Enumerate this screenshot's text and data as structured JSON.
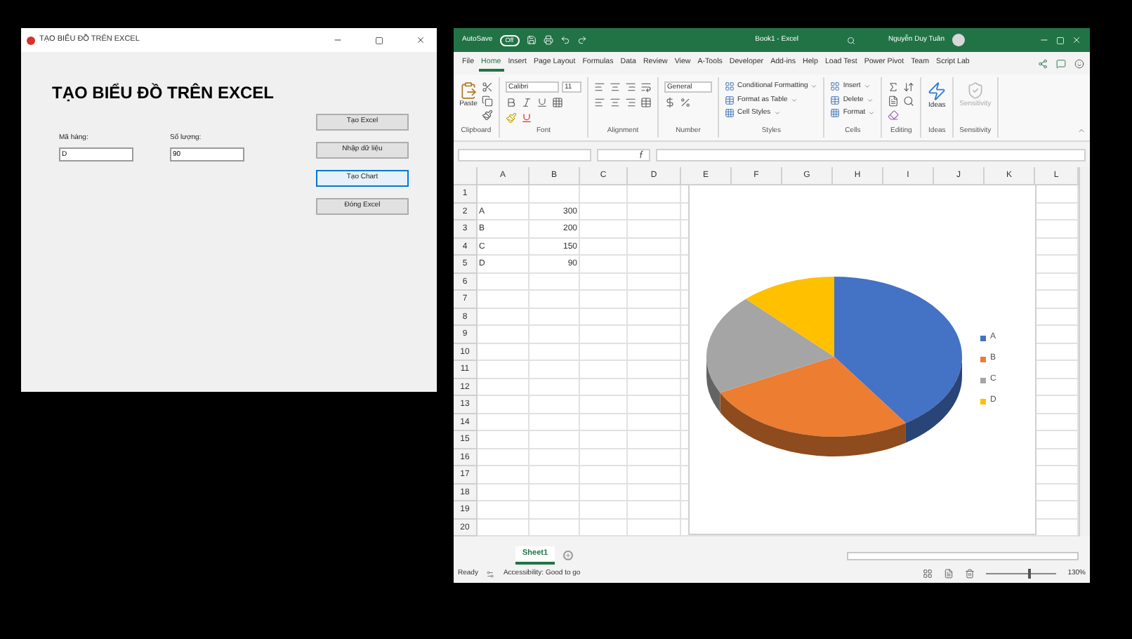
{
  "app_window": {
    "title": "TẠO BIỂU ĐỒ TRÊN EXCEL",
    "heading": "TẠO BIỂU ĐỒ TRÊN EXCEL",
    "fields": [
      {
        "label": "Mã hàng:",
        "value": "D"
      },
      {
        "label": "Số lượng:",
        "value": "90"
      }
    ],
    "buttons": [
      {
        "label": "Tạo Excel",
        "selected": false
      },
      {
        "label": "Nhập dữ liệu",
        "selected": false
      },
      {
        "label": "Tạo Chart",
        "selected": true
      },
      {
        "label": "Đóng Excel",
        "selected": false
      }
    ]
  },
  "excel": {
    "title_bar": {
      "autosave_label": "AutoSave",
      "autosave_toggle": "Off",
      "document_title": "Book1 - Excel",
      "user": "Nguyễn Duy Tuân"
    },
    "ribbon_tabs": [
      {
        "label": "File",
        "selected": false
      },
      {
        "label": "Home",
        "selected": true
      },
      {
        "label": "Insert",
        "selected": false
      },
      {
        "label": "Page Layout",
        "selected": false
      },
      {
        "label": "Formulas",
        "selected": false
      },
      {
        "label": "Data",
        "selected": false
      },
      {
        "label": "Review",
        "selected": false
      },
      {
        "label": "View",
        "selected": false
      },
      {
        "label": "A-Tools",
        "selected": false
      },
      {
        "label": "Developer",
        "selected": false
      },
      {
        "label": "Add-ins",
        "selected": false
      },
      {
        "label": "Help",
        "selected": false
      },
      {
        "label": "Load Test",
        "selected": false
      },
      {
        "label": "Power Pivot",
        "selected": false
      },
      {
        "label": "Team",
        "selected": false
      },
      {
        "label": "Script Lab",
        "selected": false
      }
    ],
    "ribbon_groups": [
      {
        "kind": "clipboard",
        "label": "Clipboard",
        "items": [
          "Paste"
        ]
      },
      {
        "kind": "font",
        "label": "Font",
        "items": [
          "Calibri",
          "11"
        ]
      },
      {
        "kind": "alignment",
        "label": "Alignment"
      },
      {
        "kind": "number",
        "label": "Number",
        "items": [
          "General"
        ]
      },
      {
        "kind": "styles",
        "label": "Styles",
        "items": [
          "Conditional Formatting",
          "Format as Table",
          "Cell Styles"
        ]
      },
      {
        "kind": "cells",
        "label": "Cells",
        "items": [
          "Insert",
          "Delete",
          "Format"
        ]
      },
      {
        "kind": "editing",
        "label": "Editing"
      },
      {
        "kind": "ideas",
        "label": "Ideas",
        "items": [
          "Ideas"
        ]
      },
      {
        "kind": "sensitivity",
        "label": "Sensitivity",
        "items": [
          "Sensitivity"
        ]
      }
    ],
    "grid": {
      "columns": [
        "A",
        "B",
        "C",
        "D",
        "E",
        "F",
        "G",
        "H",
        "I",
        "J",
        "K",
        "L"
      ],
      "rows": [
        {
          "label": "1"
        },
        {
          "label": "2",
          "cells": [
            {
              "kind": "text",
              "value": "A"
            },
            {
              "kind": "number",
              "value": "300"
            }
          ]
        },
        {
          "label": "3",
          "cells": [
            {
              "kind": "text",
              "value": "B"
            },
            {
              "kind": "number",
              "value": "200"
            }
          ]
        },
        {
          "label": "4",
          "cells": [
            {
              "kind": "text",
              "value": "C"
            },
            {
              "kind": "number",
              "value": "150"
            }
          ]
        },
        {
          "label": "5",
          "cells": [
            {
              "kind": "text",
              "value": "D"
            },
            {
              "kind": "number",
              "value": "90"
            }
          ]
        },
        {
          "label": "6"
        },
        {
          "label": "7"
        },
        {
          "label": "8"
        },
        {
          "label": "9"
        },
        {
          "label": "10"
        },
        {
          "label": "11"
        },
        {
          "label": "12"
        },
        {
          "label": "13"
        },
        {
          "label": "14"
        },
        {
          "label": "15"
        },
        {
          "label": "16"
        },
        {
          "label": "17"
        },
        {
          "label": "18"
        },
        {
          "label": "19"
        },
        {
          "label": "20"
        }
      ]
    },
    "chart": {
      "legend": [
        "A",
        "B",
        "C",
        "D"
      ]
    },
    "sheet_tabs": [
      {
        "label": "Sheet1",
        "selected": true
      }
    ],
    "status_bar": {
      "status": "Ready",
      "accessibility": "Accessibility: Good to go",
      "zoom": "130%",
      "zoom_slider": {
        "level": 0.6
      }
    }
  }
}
